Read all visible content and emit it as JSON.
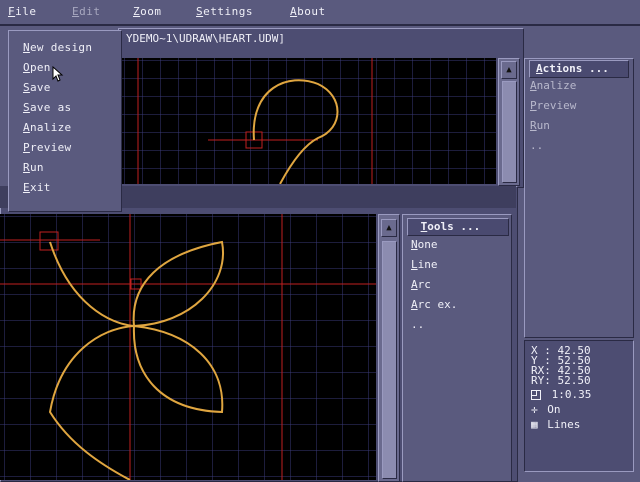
{
  "menubar": {
    "items": [
      {
        "label": "File",
        "hotkey": "F",
        "rest": "ile"
      },
      {
        "label": "Edit",
        "hotkey": "E",
        "rest": "dit"
      },
      {
        "label": "Zoom",
        "hotkey": "Z",
        "rest": "oom"
      },
      {
        "label": "Settings",
        "hotkey": "S",
        "rest": "ettings"
      },
      {
        "label": "About",
        "hotkey": "A",
        "rest": "bout"
      }
    ]
  },
  "file_menu": {
    "items": [
      {
        "label": "New design",
        "hotkey": "N",
        "rest": "ew design"
      },
      {
        "label": "Open",
        "hotkey": "O",
        "rest": "pen"
      },
      {
        "label": "Save",
        "hotkey": "S",
        "rest": "ave"
      },
      {
        "label": "Save as",
        "hotkey": "S",
        "rest": "ave as"
      },
      {
        "label": "Analize",
        "hotkey": "A",
        "rest": "nalize"
      },
      {
        "label": "Preview",
        "hotkey": "P",
        "rest": "review"
      },
      {
        "label": "Run",
        "hotkey": "R",
        "rest": "un"
      },
      {
        "label": "Exit",
        "hotkey": "E",
        "rest": "xit"
      }
    ]
  },
  "design_window": {
    "path": "YDEMO~1\\UDRAW\\HEART.UDW]"
  },
  "actions_panel": {
    "title": "Actions ...",
    "title_hotkey": "A",
    "title_rest": "ctions ...",
    "items": [
      {
        "hotkey": "A",
        "rest": "nalize"
      },
      {
        "hotkey": "P",
        "rest": "review"
      },
      {
        "hotkey": "R",
        "rest": "un"
      },
      {
        "hotkey": "",
        "rest": ".."
      }
    ]
  },
  "tools_panel": {
    "title": "Tools ...",
    "title_hotkey": "T",
    "title_rest": "ools ...",
    "items": [
      {
        "hotkey": "N",
        "rest": "one"
      },
      {
        "hotkey": "L",
        "rest": "ine"
      },
      {
        "hotkey": "A",
        "rest": "rc"
      },
      {
        "hotkey": "A",
        "rest": "rc ex."
      },
      {
        "hotkey": "",
        "rest": ".."
      }
    ]
  },
  "status": {
    "x": "X  : 42.50",
    "y": "Y  : 52.50",
    "rx": "RX: 42.50",
    "ry": "RY: 52.50",
    "scale": "1:0.35",
    "snap": "On",
    "grid": "Lines"
  },
  "icons": {
    "scroll_up": "scroll-up-arrow-icon",
    "scale": "scale-box-icon",
    "snap": "crosshair-icon",
    "grid": "grid-icon",
    "cursor": "mouse-pointer-icon"
  },
  "colors": {
    "curve": "#e0a640",
    "guide": "#c02020",
    "grid": "#3a3a78"
  }
}
